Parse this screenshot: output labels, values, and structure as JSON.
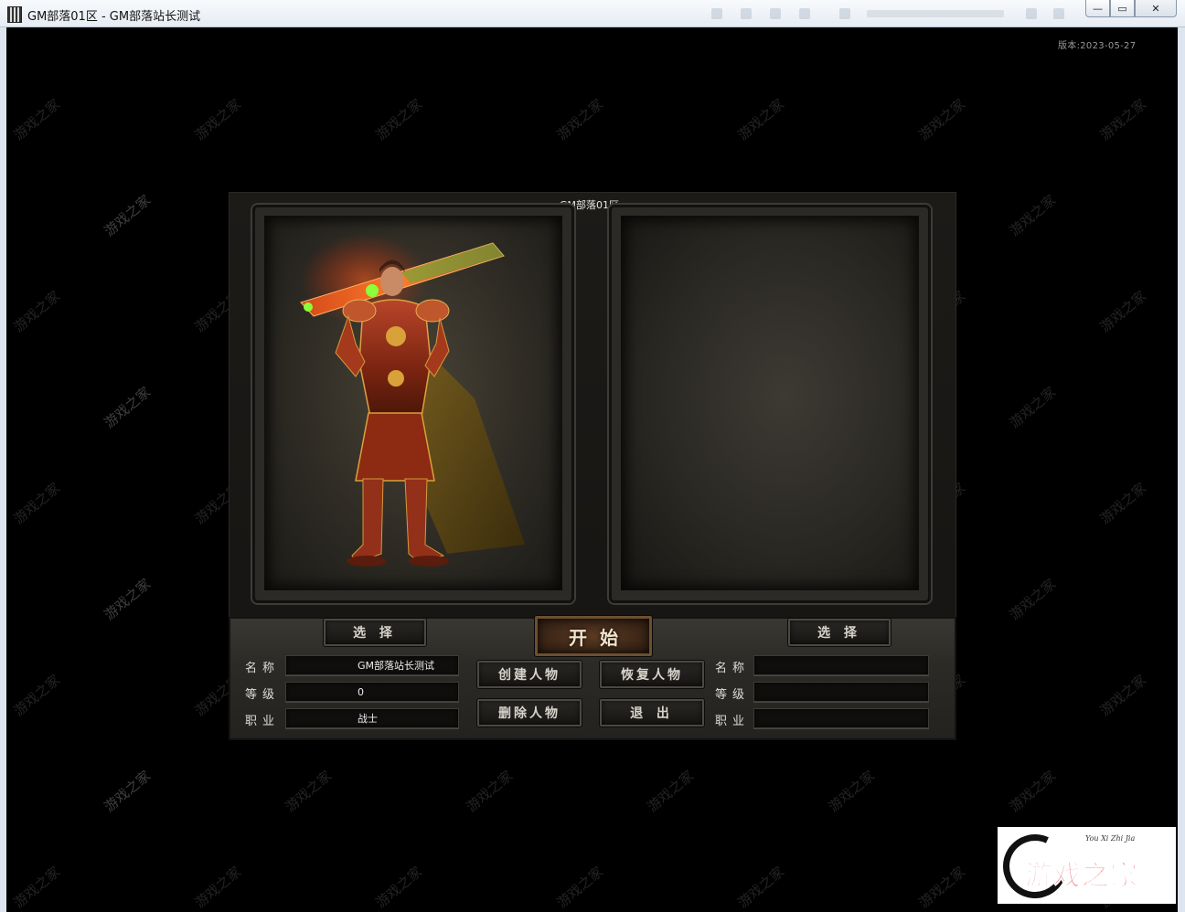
{
  "window": {
    "title": "GM部落01区 - GM部落站长测试",
    "minimize_glyph": "—",
    "maximize_glyph": "▭",
    "close_glyph": "✕"
  },
  "version": "版本:2023-05-27",
  "server_name": "GM部落01区",
  "watermark_text": "游戏之家",
  "left_slot": {
    "select_label": "选 择",
    "name_label": "名称",
    "level_label": "等级",
    "class_label": "职业",
    "name_value": "GM部落站长测试",
    "level_value": "0",
    "class_value": "战士"
  },
  "right_slot": {
    "select_label": "选 择",
    "name_label": "名称",
    "level_label": "等级",
    "class_label": "职业",
    "name_value": "",
    "level_value": "",
    "class_value": ""
  },
  "buttons": {
    "start": "开始",
    "create": "创建人物",
    "restore": "恢复人物",
    "delete": "删除人物",
    "exit": "退 出"
  },
  "logo": {
    "script": "You Xi Zhi Jia",
    "text": "游戏之家"
  },
  "colors": {
    "brand_red": "#e0141c",
    "panel_stone": "#2c2a26"
  }
}
